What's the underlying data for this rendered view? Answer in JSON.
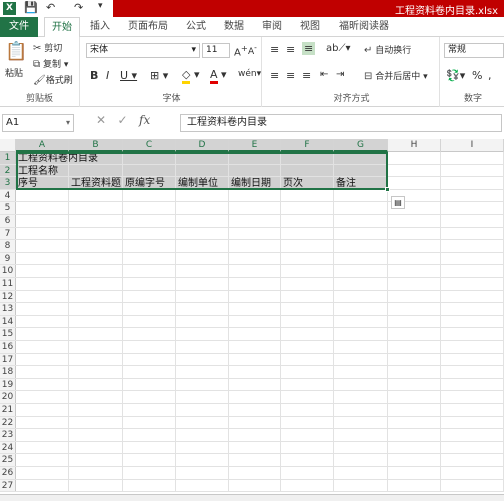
{
  "window": {
    "title": "工程资料卷内目录.xlsx"
  },
  "tabs": [
    {
      "label": "文件"
    },
    {
      "label": "开始"
    },
    {
      "label": "插入"
    },
    {
      "label": "页面布局"
    },
    {
      "label": "公式"
    },
    {
      "label": "数据"
    },
    {
      "label": "审阅"
    },
    {
      "label": "视图"
    },
    {
      "label": "福昕阅读器"
    }
  ],
  "clipboard": {
    "paste": "粘贴",
    "cut": "剪切",
    "copy": "复制",
    "format_painter": "格式刷",
    "label": "剪贴板"
  },
  "font": {
    "family": "宋体",
    "size": "11",
    "label": "字体"
  },
  "alignment": {
    "wrap": "自动换行",
    "merge": "合并后居中",
    "label": "对齐方式"
  },
  "number": {
    "format": "常规",
    "label": "数字"
  },
  "formula_bar": {
    "name_box": "A1",
    "fx": "fx",
    "content": "工程资料卷内目录"
  },
  "columns": [
    "A",
    "B",
    "C",
    "D",
    "E",
    "F",
    "G",
    "H",
    "I"
  ],
  "rows": [
    "1",
    "2",
    "3",
    "4",
    "5",
    "6",
    "7",
    "8",
    "9",
    "10",
    "11",
    "12",
    "13",
    "14",
    "15",
    "16",
    "17",
    "18",
    "19",
    "20",
    "21",
    "22",
    "23",
    "24",
    "25",
    "26",
    "27"
  ],
  "cells": {
    "A1": "工程资料卷内目录",
    "A2": "工程名称",
    "A3": "序号",
    "B3": "工程资料题",
    "C3": "原编字号",
    "D3": "编制单位",
    "E3": "编制日期",
    "F3": "页次",
    "G3": "备注"
  },
  "colors": {
    "accent": "#217346",
    "title_bar": "#c00000"
  }
}
